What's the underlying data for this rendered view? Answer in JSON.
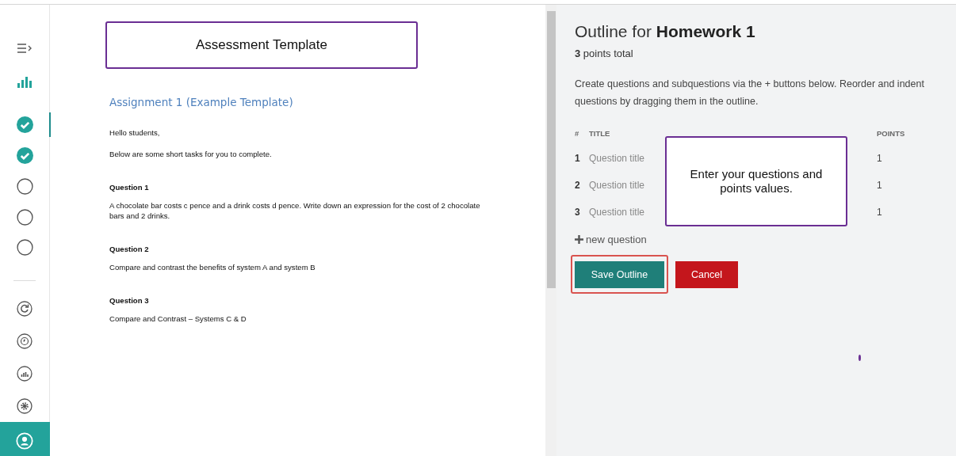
{
  "sidebar": {
    "progress": [
      {
        "checked": true,
        "selected": true
      },
      {
        "checked": true,
        "selected": false
      },
      {
        "checked": false,
        "selected": false
      },
      {
        "checked": false,
        "selected": false
      },
      {
        "checked": false,
        "selected": false
      }
    ]
  },
  "document": {
    "callout": "Assessment Template",
    "heading": "Assignment 1 (Example Template)",
    "paragraphs": [
      "Hello students,",
      "Below are some short tasks for you to complete."
    ],
    "questions": [
      {
        "title": "Question 1",
        "text": "A chocolate bar costs c pence and a drink costs d pence. Write down an expression for the cost of 2 chocolate bars and 2 drinks."
      },
      {
        "title": "Question 2",
        "text": "Compare and contrast the benefits of system A and system B"
      },
      {
        "title": "Question 3",
        "text": "Compare and Contrast – Systems C & D"
      }
    ]
  },
  "outline": {
    "title_prefix": "Outline for",
    "title_name": "Homework 1",
    "total_number": "3",
    "total_label": "points total",
    "instructions": "Create questions and subquestions via the + buttons below. Reorder and indent questions by dragging them in the outline.",
    "columns": [
      "#",
      "TITLE",
      "POINTS"
    ],
    "rows": [
      {
        "number": "1",
        "placeholder": "Question title",
        "points": "1"
      },
      {
        "number": "2",
        "placeholder": "Question title",
        "points": "1"
      },
      {
        "number": "3",
        "placeholder": "Question title",
        "points": "1"
      }
    ],
    "callout": "Enter your questions and points values.",
    "add_label": "new question",
    "save": "Save Outline",
    "cancel": "Cancel"
  }
}
